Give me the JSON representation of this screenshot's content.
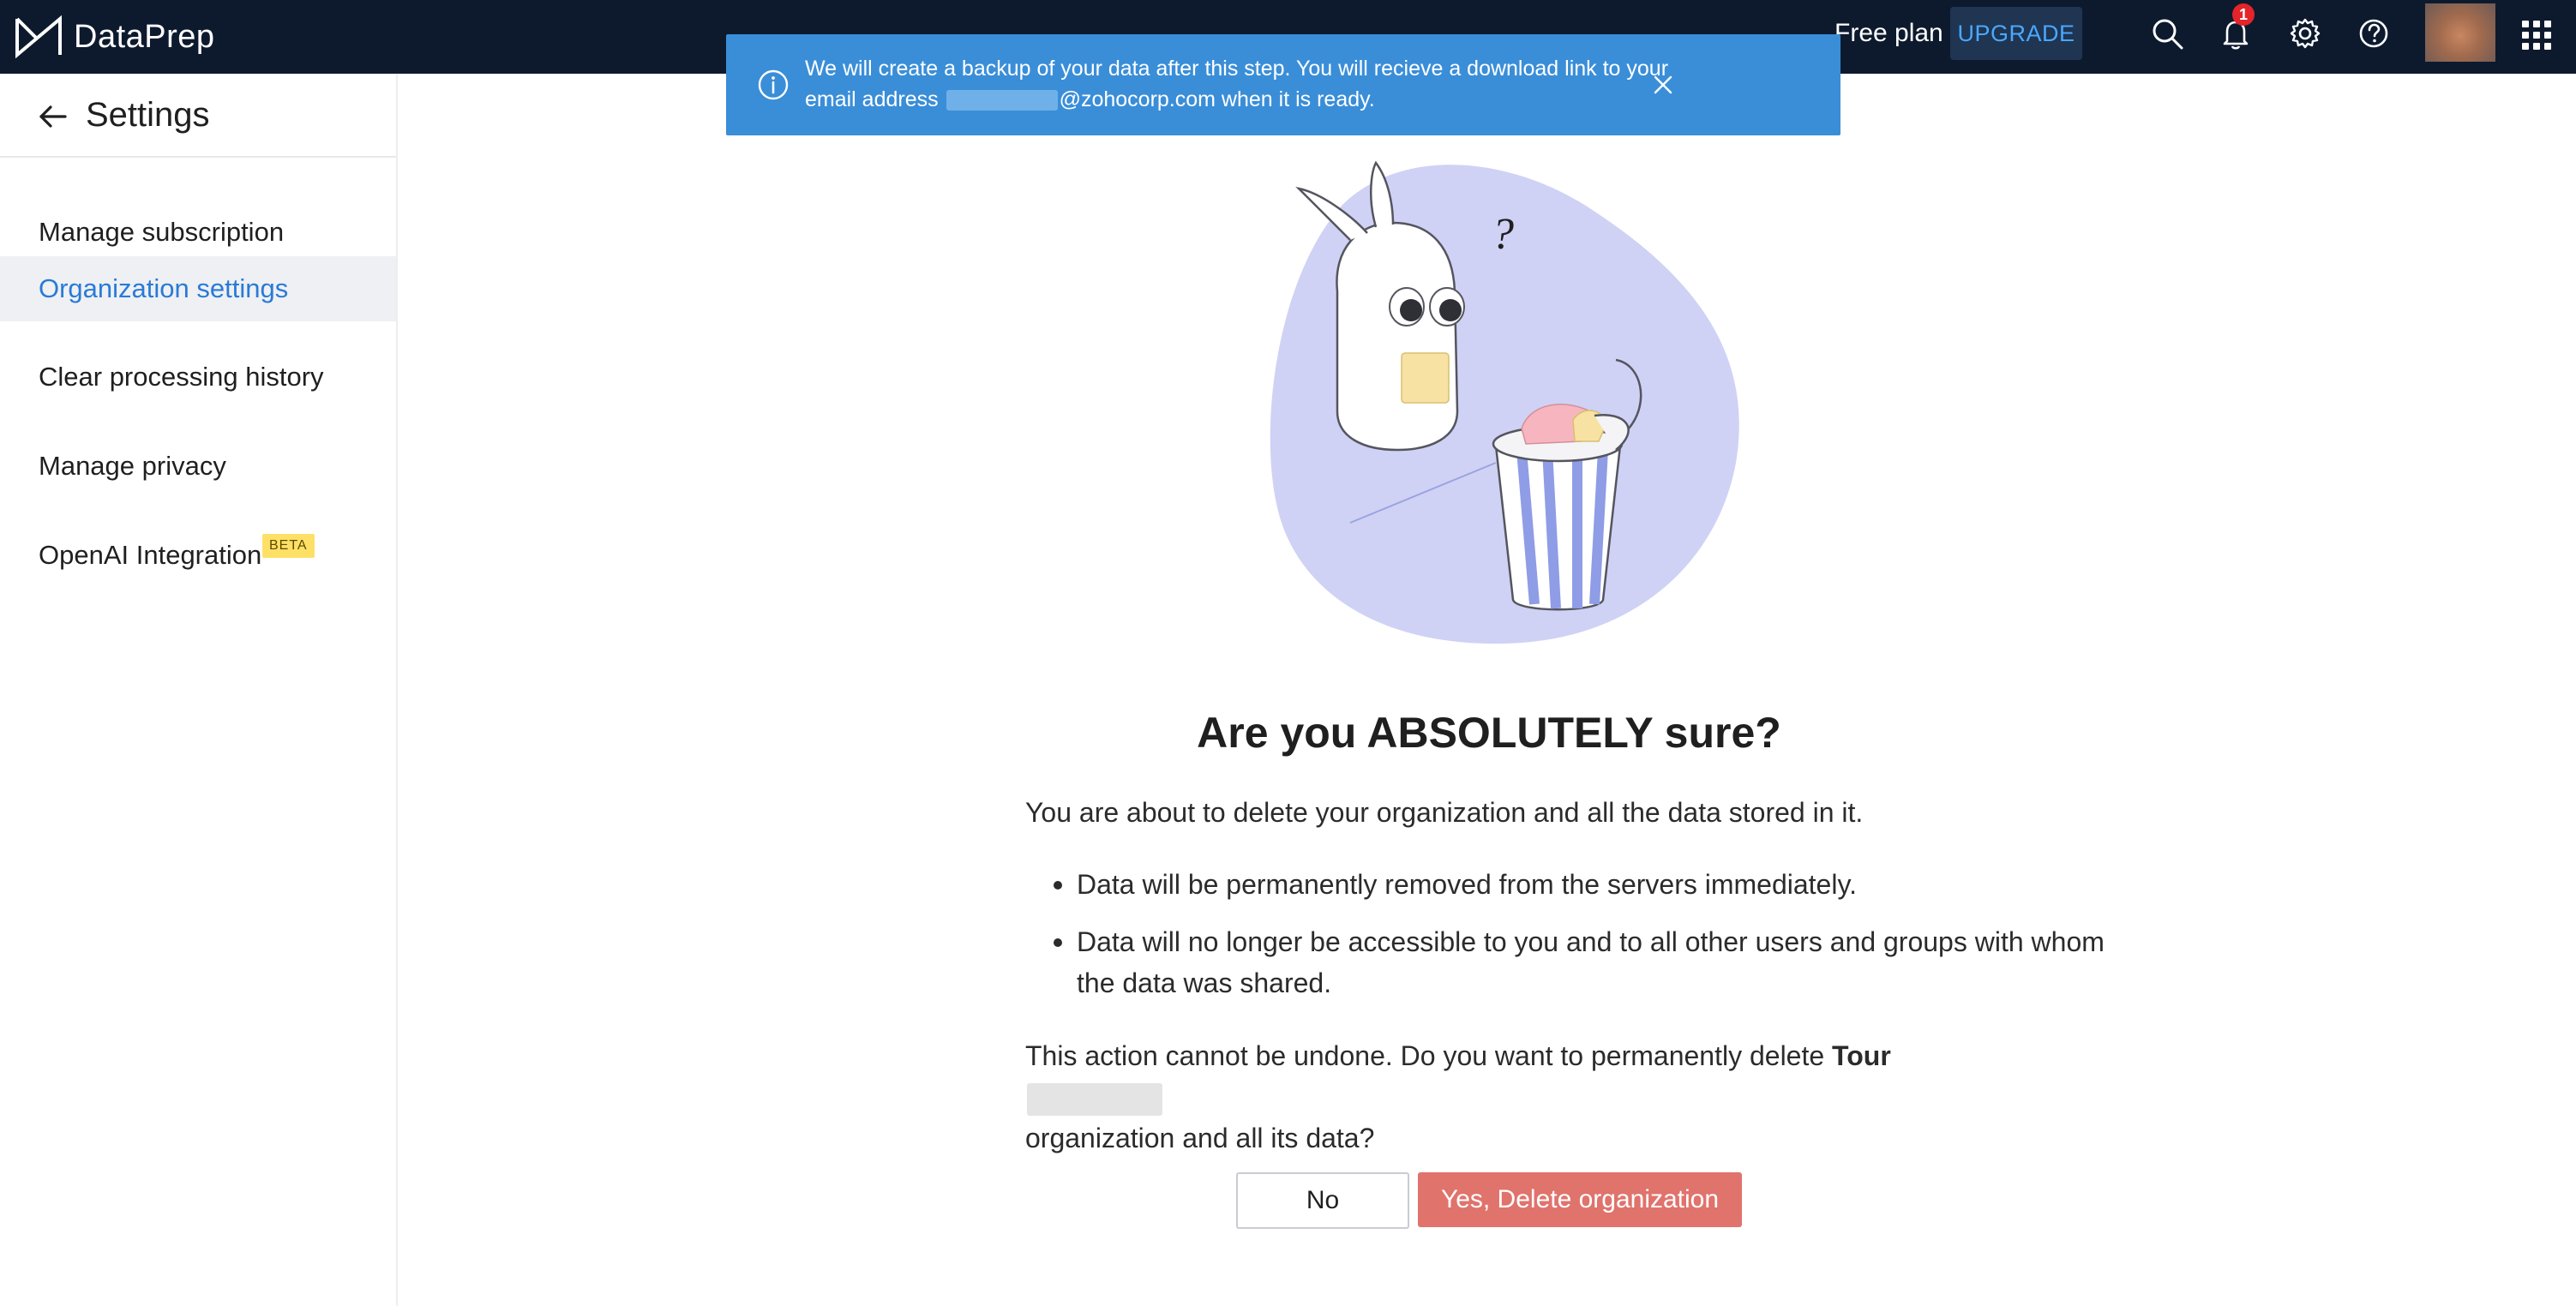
{
  "header": {
    "app_name": "DataPrep",
    "plan_label": "Free plan",
    "upgrade_label": "UPGRADE",
    "notification_count": "1"
  },
  "sidebar": {
    "title": "Settings",
    "items": [
      {
        "label": "Manage subscription"
      },
      {
        "label": "Organization settings"
      },
      {
        "label": "Clear processing history"
      },
      {
        "label": "Manage privacy"
      },
      {
        "label": "OpenAI Integration",
        "badge": "BETA"
      }
    ]
  },
  "banner": {
    "line1": "We will create a backup of your data after this step. You will recieve a download link to your",
    "line2_prefix": "email address",
    "line2_suffix": "@zohocorp.com when it is ready."
  },
  "dialog": {
    "title": "Are you ABSOLUTELY sure?",
    "intro": "You are about to delete your organization and all the data stored in it.",
    "bullets": [
      "Data will be permanently removed from the servers immediately.",
      "Data will no longer be accessible to you and to all other users and groups with whom",
      "the data was shared."
    ],
    "confirm_prefix": "This action cannot be undone. Do you want to permanently delete",
    "org_name": "Tour",
    "confirm_suffix": "organization and all its data?",
    "no_label": "No",
    "delete_label": "Yes, Delete organization"
  },
  "colors": {
    "topbar": "#0d1a2e",
    "banner": "#3a8ed8",
    "active_nav_text": "#2a7ad6",
    "delete_button": "#e0736c",
    "upgrade_text": "#4aa8ff",
    "notification_badge": "#e3242b"
  }
}
